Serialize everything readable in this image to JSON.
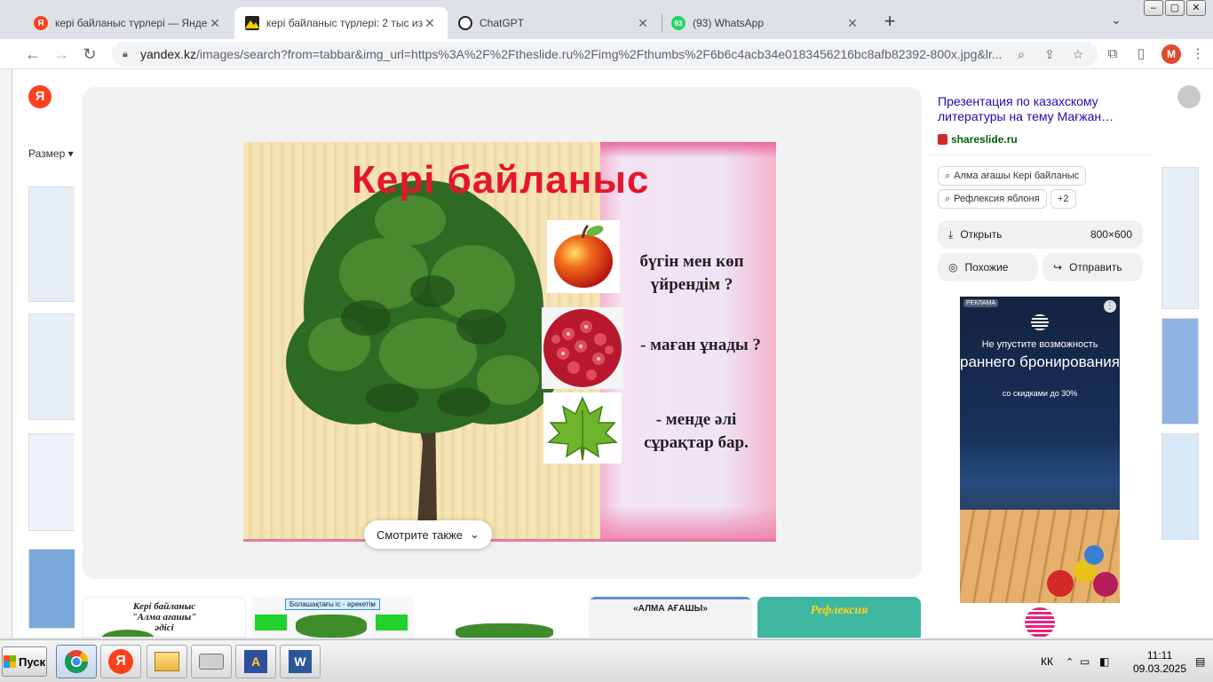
{
  "browser": {
    "tabs": [
      {
        "title": "кері байланыс түрлері — Яндекс: на",
        "icon": "yandex-icon",
        "active": false
      },
      {
        "title": "кері байланыс түрлері: 2 тыс изоб",
        "icon": "yandex-images-icon",
        "active": true
      },
      {
        "title": "ChatGPT",
        "icon": "chatgpt-icon",
        "active": false
      },
      {
        "title": "(93) WhatsApp",
        "icon": "whatsapp-icon",
        "active": false,
        "badge": "93"
      }
    ],
    "url_host": "yandex.kz",
    "url_rest": "/images/search?from=tabbar&img_url=https%3A%2F%2Ftheslide.ru%2Fimg%2Fthumbs%2F6b6c4acb34e0183456216bc8afb82392-800x.jpg&lr...",
    "profile_initial": "M"
  },
  "page_behind": {
    "filter_label": "Размер",
    "yandex_letter": "Я"
  },
  "slide": {
    "heading": "Кері  байланыс",
    "questions": [
      [
        "бүгін  мен  көп",
        "үйрендім ?"
      ],
      [
        "- маған  ұнады ?"
      ],
      [
        "- менде  әлі",
        "сұрақтар  бар."
      ]
    ]
  },
  "info": {
    "title": "Презентация по казахскому литературы на тему Мағжан…",
    "source": "shareslide.ru",
    "tags": [
      "Алма ағашы Кері байланыс",
      "Рефлексия яблоня",
      "+2"
    ],
    "open_label": "Открыть",
    "size": "800×600",
    "similar_label": "Похожие",
    "share_label": "Отправить"
  },
  "ad": {
    "label": "РЕКЛАМА",
    "line1": "Не упустите возможность",
    "line2": "раннего бронирования",
    "line3": "со скидками до 30%"
  },
  "related": {
    "see_also": "Смотрите также",
    "thumbs": [
      {
        "caption": "Кері байланыс\n\"Алма ағашы\"\nәдісі",
        "bg": "#ffffff"
      },
      {
        "caption": "Болашақтағы іс - әрекетім",
        "bg": "#f7f7f7"
      },
      {
        "caption": "",
        "bg": "#ffffff"
      },
      {
        "caption": "«АЛМА  АҒАШЫ»",
        "bg": "#f3f3f3"
      },
      {
        "caption": "Рефлексия",
        "bg": "#3fb7a0"
      }
    ]
  },
  "taskbar": {
    "start_label": "Пуск",
    "lang": "КК",
    "time": "11:11",
    "date": "09.03.2025"
  },
  "colors": {
    "accent_red": "#e5162c",
    "link_blue": "#1a0dab",
    "source_green": "#006000"
  }
}
